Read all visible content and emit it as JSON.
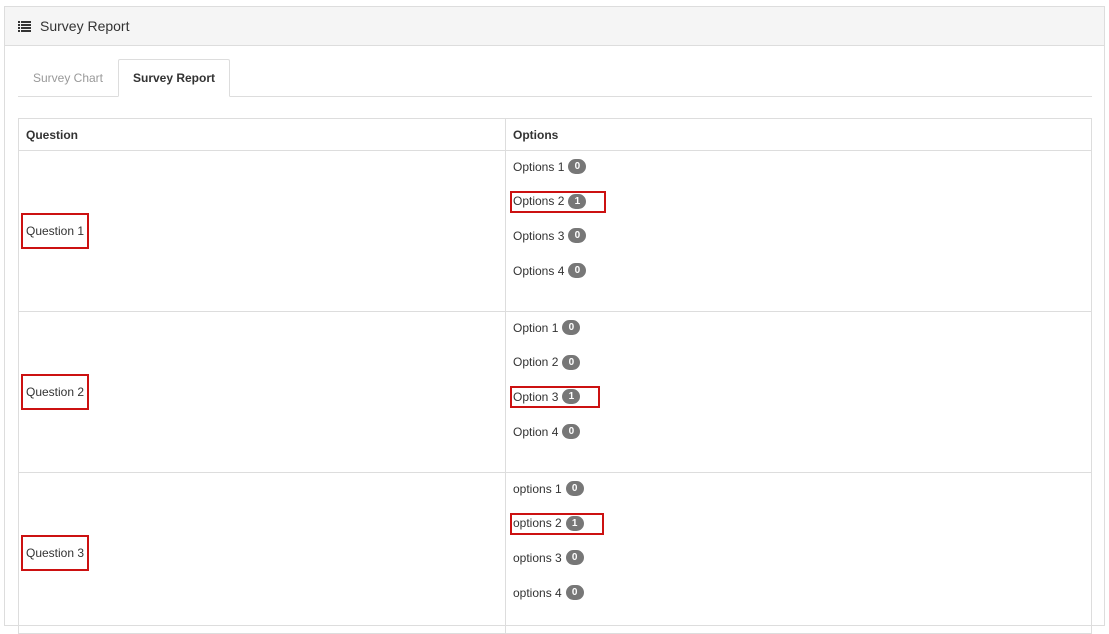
{
  "panel": {
    "title": "Survey Report",
    "icon": "list-icon"
  },
  "tabs": [
    {
      "label": "Survey Chart",
      "active": false
    },
    {
      "label": "Survey Report",
      "active": true
    }
  ],
  "table": {
    "headers": {
      "question": "Question",
      "options": "Options"
    },
    "rows": [
      {
        "question": "Question 1",
        "options": [
          {
            "label": "Options 1",
            "count": "0"
          },
          {
            "label": "Options 2",
            "count": "1"
          },
          {
            "label": "Options 3",
            "count": "0"
          },
          {
            "label": "Options 4",
            "count": "0"
          }
        ]
      },
      {
        "question": "Question 2",
        "options": [
          {
            "label": "Option 1",
            "count": "0"
          },
          {
            "label": "Option 2",
            "count": "0"
          },
          {
            "label": "Option 3",
            "count": "1"
          },
          {
            "label": "Option 4",
            "count": "0"
          }
        ]
      },
      {
        "question": "Question 3",
        "options": [
          {
            "label": "options 1",
            "count": "0"
          },
          {
            "label": "options 2",
            "count": "1"
          },
          {
            "label": "options 3",
            "count": "0"
          },
          {
            "label": "options 4",
            "count": "0"
          }
        ]
      }
    ]
  },
  "colors": {
    "highlight": "#cc1111",
    "badge": "#777777"
  }
}
